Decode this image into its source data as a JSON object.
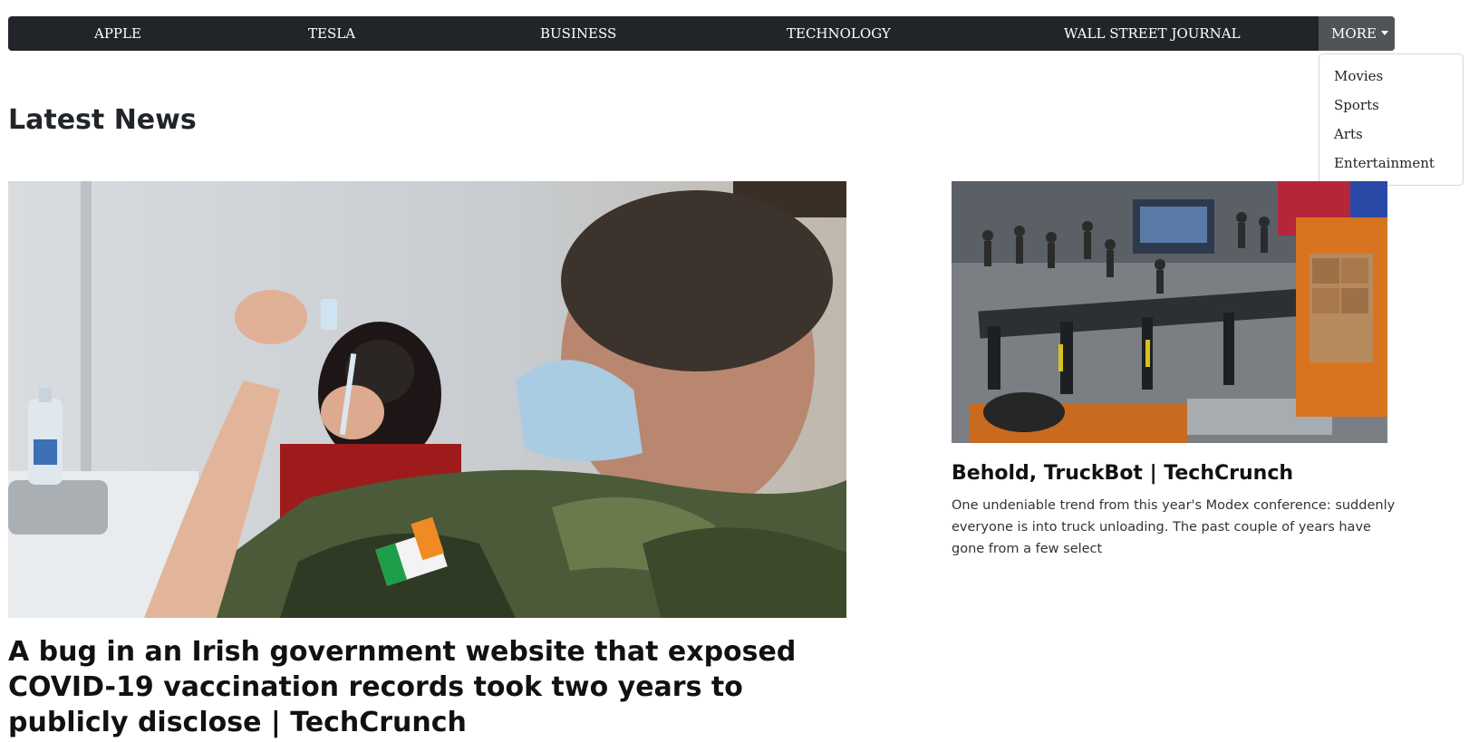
{
  "nav": {
    "items": [
      {
        "label": "APPLE"
      },
      {
        "label": "TESLA"
      },
      {
        "label": "BUSINESS"
      },
      {
        "label": "TECHNOLOGY"
      },
      {
        "label": "WALL STREET JOURNAL"
      }
    ],
    "more_label": "MORE",
    "more_icon": "caret-down-icon",
    "dropdown": [
      {
        "label": "Movies"
      },
      {
        "label": "Sports"
      },
      {
        "label": "Arts"
      },
      {
        "label": "Entertainment"
      }
    ]
  },
  "page": {
    "title": "Latest News"
  },
  "articles": [
    {
      "headline": "A bug in an Irish government website that exposed COVID-19 vaccination records took two years to publicly disclose | TechCrunch",
      "description": "",
      "image": "vaccination-photo"
    },
    {
      "headline": "Behold, TruckBot | TechCrunch",
      "description": "One undeniable trend from this year's Modex conference: suddenly everyone is into truck unloading. The past couple of years have gone from a few select",
      "image": "truck-unloading-robot-photo"
    }
  ],
  "colors": {
    "navbar_bg": "#212529",
    "more_bg": "#505357",
    "text": "#212529"
  }
}
